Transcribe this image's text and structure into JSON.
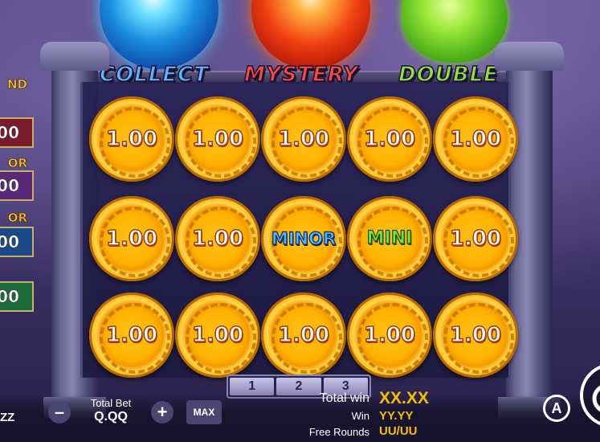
{
  "features": {
    "collect": {
      "label": "COLLECT",
      "orb_color": "#1a8fe0"
    },
    "mystery": {
      "label": "MYSTERY",
      "orb_color": "#f04010"
    },
    "double": {
      "label": "DOUBLE",
      "orb_color": "#4db018"
    }
  },
  "jackpot_panel": {
    "rows": [
      {
        "label": "ND",
        "value": "00",
        "color": "#7a1a2a"
      },
      {
        "label": "OR",
        "value": "00",
        "color": "#5a2a7a"
      },
      {
        "label": "OR",
        "value": "00",
        "color": "#1a4a8a"
      },
      {
        "label": "",
        "value": "00",
        "color": "#1a6a3a"
      }
    ]
  },
  "reels": {
    "rows": [
      [
        "1.00",
        "1.00",
        "1.00",
        "1.00",
        "1.00"
      ],
      [
        "1.00",
        "1.00",
        "MINOR",
        "MINI",
        "1.00"
      ],
      [
        "1.00",
        "1.00",
        "1.00",
        "1.00",
        "1.00"
      ]
    ],
    "coin_color": "#ffb300"
  },
  "pager": {
    "pages": [
      "1",
      "2",
      "3"
    ]
  },
  "footer": {
    "balance_fragment": "ZZ",
    "minus_label": "–",
    "plus_label": "+",
    "total_bet_label": "Total Bet",
    "total_bet_value": "Q.QQ",
    "max_label": "MAX",
    "total_win_label": "Total win",
    "total_win_value": "XX.XX",
    "win_label": "Win",
    "win_value": "YY.YY",
    "free_rounds_label": "Free Rounds",
    "free_rounds_value": "UU/UU",
    "autoplay_label": "A",
    "accent_color": "#f3c000"
  }
}
